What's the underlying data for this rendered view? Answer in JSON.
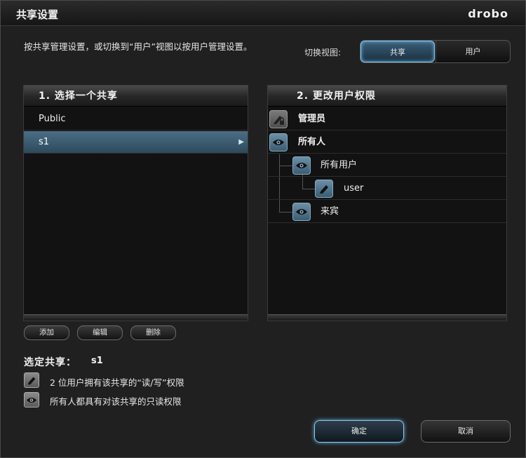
{
  "window": {
    "title": "共享设置",
    "logo": "drobo"
  },
  "description": "按共享管理设置，或切换到“用户”视图以按用户管理设置。",
  "view_switch": {
    "label": "切换视图:",
    "options": [
      "共享",
      "用户"
    ],
    "selected": "共享"
  },
  "shares_panel": {
    "title": "1. 选择一个共享",
    "items": [
      {
        "label": "Public"
      },
      {
        "label": "s1"
      }
    ],
    "selected": "s1",
    "buttons": {
      "add": "添加",
      "edit": "编辑",
      "delete": "删除"
    }
  },
  "permissions_panel": {
    "title": "2. 更改用户权限",
    "rows": [
      {
        "label": "管理员",
        "icon": "pen-lock-icon",
        "level": 0
      },
      {
        "label": "所有人",
        "icon": "eye-icon",
        "level": 0
      },
      {
        "label": "所有用户",
        "icon": "eye-icon",
        "level": 1
      },
      {
        "label": "user",
        "icon": "pen-icon",
        "level": 2
      },
      {
        "label": "来宾",
        "icon": "eye-icon",
        "level": 1
      }
    ]
  },
  "selected_share": {
    "title": "选定共享：",
    "name": "s1",
    "legend": [
      {
        "icon": "pen-icon",
        "text": "2 位用户拥有该共享的“读/写”权限"
      },
      {
        "icon": "eye-icon",
        "text": "所有人都具有对该共享的只读权限"
      }
    ]
  },
  "footer": {
    "ok": "确定",
    "cancel": "取消"
  },
  "colors": {
    "accent": "#8fc8ef",
    "selected_row": "#3d5d72",
    "background": "#202020"
  }
}
